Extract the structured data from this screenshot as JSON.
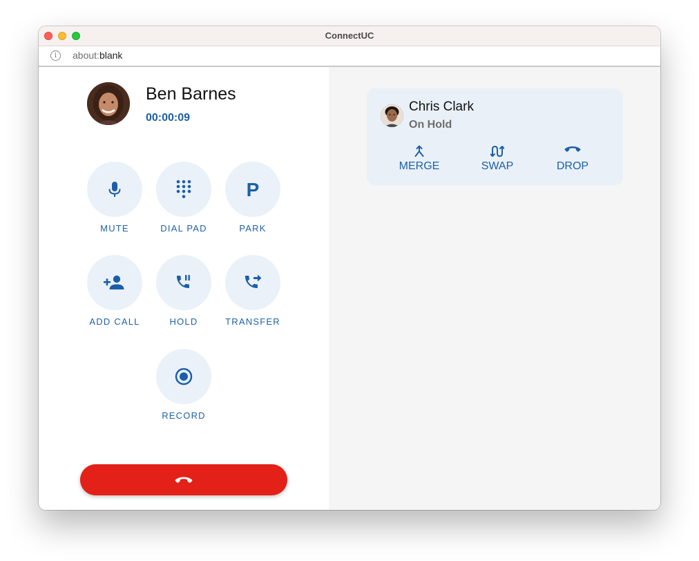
{
  "window": {
    "title": "ConnectUC"
  },
  "address_bar": {
    "scheme": "about:",
    "path": "blank"
  },
  "active_call": {
    "contact_name": "Ben Barnes",
    "timer": "00:00:09"
  },
  "controls": {
    "mute": "MUTE",
    "dial_pad": "DIAL PAD",
    "park": "PARK",
    "add_call": "ADD CALL",
    "hold": "HOLD",
    "transfer": "TRANSFER",
    "record": "RECORD"
  },
  "park_glyph": "P",
  "held_call": {
    "contact_name": "Chris Clark",
    "status": "On Hold",
    "actions": {
      "merge": "MERGE",
      "swap": "SWAP",
      "drop": "DROP"
    }
  },
  "icons": [
    "info-icon",
    "microphone-icon",
    "dialpad-icon",
    "park-icon",
    "add-person-icon",
    "phone-pause-icon",
    "phone-forward-icon",
    "record-icon",
    "hang-up-icon",
    "merge-icon",
    "swap-icon",
    "drop-call-icon"
  ],
  "colors": {
    "accent": "#1c5fa8",
    "button_bg": "#eaf1f8",
    "hangup": "#e32118",
    "card_bg": "#e9f0f8",
    "right_pane_bg": "#f5f5f5"
  }
}
